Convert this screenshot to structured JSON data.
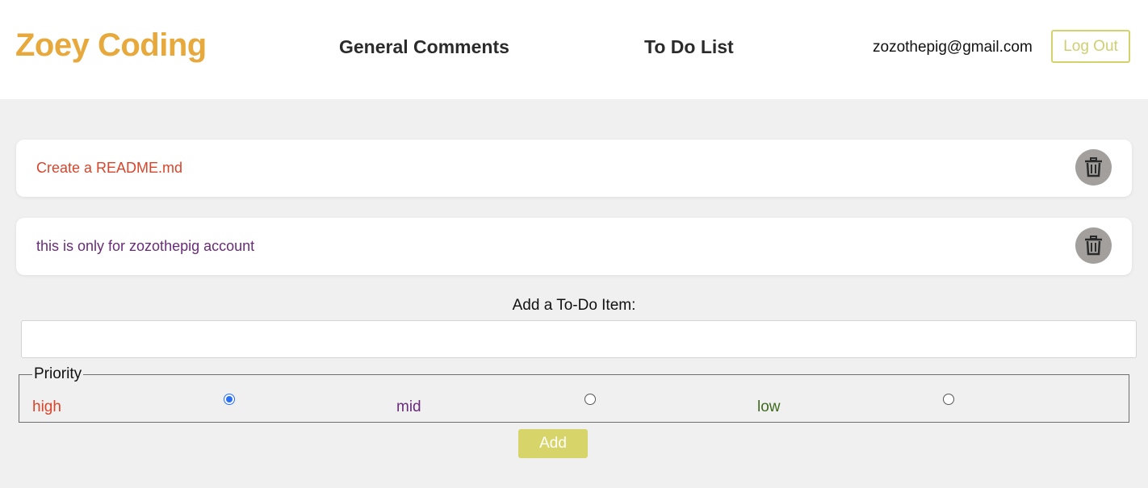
{
  "header": {
    "brand": "Zoey Coding",
    "nav": {
      "general_comments": "General Comments",
      "todo_list": "To Do List"
    },
    "user_email": "zozothepig@gmail.com",
    "logout_label": "Log Out"
  },
  "todos": [
    {
      "text": "Create a README.md",
      "priority": "high",
      "color": "#d9452b"
    },
    {
      "text": "this is only for zozothepig account",
      "priority": "mid",
      "color": "#6a2c7a"
    }
  ],
  "form": {
    "add_label": "Add a To-Do Item:",
    "input_value": "",
    "priority_legend": "Priority",
    "options": [
      {
        "label": "high",
        "color": "#d9452b",
        "checked": true
      },
      {
        "label": "mid",
        "color": "#6a2c7a",
        "checked": false
      },
      {
        "label": "low",
        "color": "#3f6b1f",
        "checked": false
      }
    ],
    "add_button": "Add"
  },
  "colors": {
    "brand": "#e7a93c",
    "accent": "#d7d56a",
    "delete_button": "#a39f9c",
    "background": "#f0f0f0"
  },
  "icons": {
    "delete": "trash-icon"
  }
}
